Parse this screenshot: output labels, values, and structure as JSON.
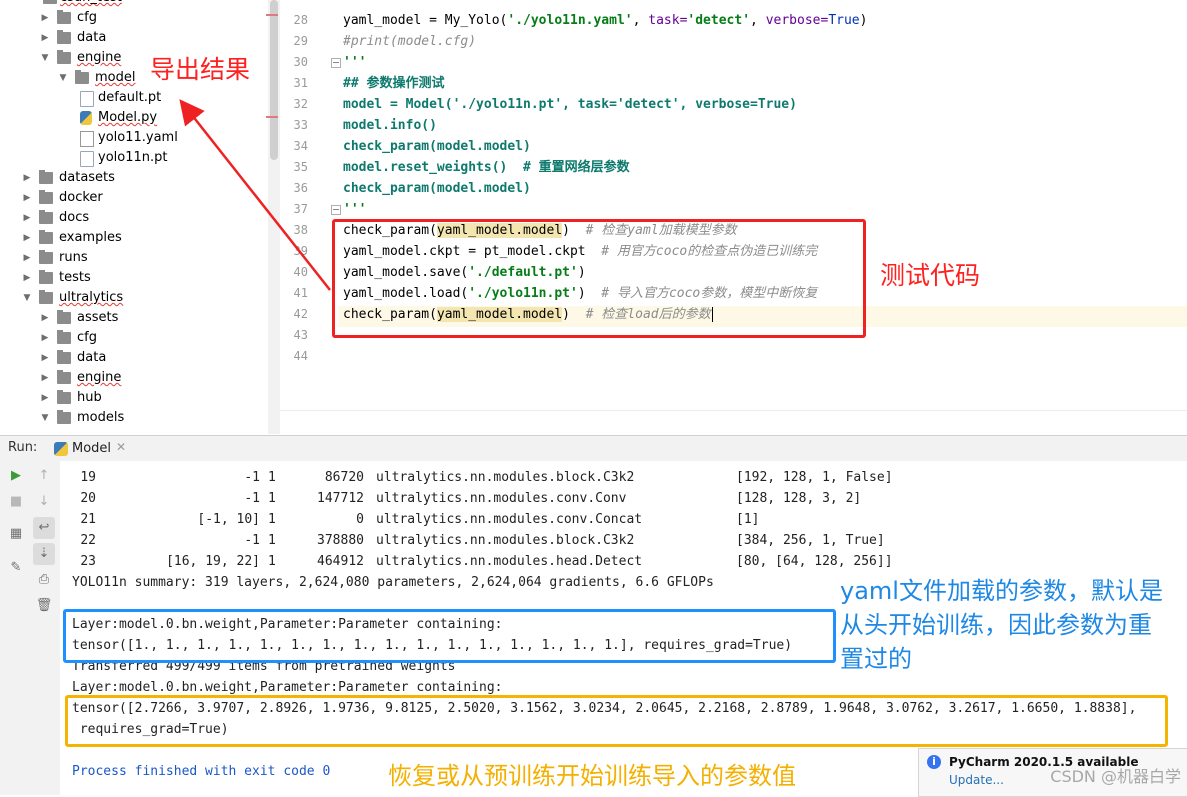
{
  "project_tree": {
    "cut_label": "csdn_test",
    "items": [
      {
        "label": "cfg",
        "type": "folder",
        "expanded": false
      },
      {
        "label": "data",
        "type": "folder",
        "expanded": false
      },
      {
        "label": "engine",
        "type": "folder",
        "expanded": true
      },
      {
        "label": "model",
        "type": "folder",
        "expanded": true
      },
      {
        "label": "default.pt",
        "type": "file"
      },
      {
        "label": "Model.py",
        "type": "python-file"
      },
      {
        "label": "yolo11.yaml",
        "type": "yaml-file"
      },
      {
        "label": "yolo11n.pt",
        "type": "file"
      },
      {
        "label": "datasets",
        "type": "folder",
        "expanded": false
      },
      {
        "label": "docker",
        "type": "folder",
        "expanded": false
      },
      {
        "label": "docs",
        "type": "folder",
        "expanded": false
      },
      {
        "label": "examples",
        "type": "folder",
        "expanded": false
      },
      {
        "label": "runs",
        "type": "folder",
        "expanded": false
      },
      {
        "label": "tests",
        "type": "folder",
        "expanded": false
      },
      {
        "label": "ultralytics",
        "type": "folder",
        "expanded": true
      },
      {
        "label": "assets",
        "type": "folder",
        "expanded": false
      },
      {
        "label": "cfg",
        "type": "folder",
        "expanded": false
      },
      {
        "label": "data",
        "type": "folder",
        "expanded": false
      },
      {
        "label": "engine",
        "type": "folder",
        "expanded": false
      },
      {
        "label": "hub",
        "type": "folder",
        "expanded": false
      },
      {
        "label": "models",
        "type": "folder",
        "expanded": true
      }
    ]
  },
  "editor": {
    "line_numbers": [
      "28",
      "29",
      "30",
      "31",
      "32",
      "33",
      "34",
      "35",
      "36",
      "37",
      "38",
      "39",
      "40",
      "41",
      "42",
      "43",
      "44"
    ],
    "lines": {
      "l28_a": "yaml_model = My_Yolo(",
      "l28_b": "'./yolo11n.yaml'",
      "l28_c": ", ",
      "l28_d": "task=",
      "l28_e": "'detect'",
      "l28_f": ", ",
      "l28_g": "verbose=",
      "l28_h": "True",
      "l28_i": ")",
      "l29": "#print(model.cfg)",
      "l30": "'''",
      "l31": "## 参数操作测试",
      "l32": "model = Model('./yolo11n.pt', task='detect', verbose=True)",
      "l33": "model.info()",
      "l34": "check_param(model.model)",
      "l35_a": "model.reset_weights()  ",
      "l35_b": "# 重置网络层参数",
      "l36": "check_param(model.model)",
      "l37": "'''",
      "l38_a": "check_param(",
      "l38_b": "yaml_model.model",
      "l38_c": ")  ",
      "l38_d": "# 检查yaml加载模型参数",
      "l39_a": "yaml_model.ckpt = pt_model.ckpt  ",
      "l39_b": "# 用官方coco的检查点伪造已训练完",
      "l40_a": "yaml_model.save(",
      "l40_b": "'./default.pt'",
      "l40_c": ")",
      "l41_a": "yaml_model.load(",
      "l41_b": "'./yolo11n.pt'",
      "l41_c": ")  ",
      "l41_d": "# 导入官方coco参数，模型中断恢复",
      "l42_a": "check_param(",
      "l42_b": "yaml_model.model",
      "l42_c": ")  ",
      "l42_d": "# 检查load后的参数"
    }
  },
  "run_window": {
    "label": "Run:",
    "tab_label": "Model",
    "table_rows": [
      {
        "idx": "19",
        "from": "-1",
        "n": "1",
        "params": "86720",
        "module": "ultralytics.nn.modules.block.C3k2",
        "args": "[192, 128, 1, False]"
      },
      {
        "idx": "20",
        "from": "-1",
        "n": "1",
        "params": "147712",
        "module": "ultralytics.nn.modules.conv.Conv",
        "args": "[128, 128, 3, 2]"
      },
      {
        "idx": "21",
        "from": "[-1, 10]",
        "n": "1",
        "params": "0",
        "module": "ultralytics.nn.modules.conv.Concat",
        "args": "[1]"
      },
      {
        "idx": "22",
        "from": "-1",
        "n": "1",
        "params": "378880",
        "module": "ultralytics.nn.modules.block.C3k2",
        "args": "[384, 256, 1, True]"
      },
      {
        "idx": "23",
        "from": "[16, 19, 22]",
        "n": "1",
        "params": "464912",
        "module": "ultralytics.nn.modules.head.Detect",
        "args": "[80, [64, 128, 256]]"
      }
    ],
    "summary": "YOLO11n summary: 319 layers, 2,624,080 parameters, 2,624,064 gradients, 6.6 GFLOPs",
    "param_header_1": "Layer:model.0.bn.weight,Parameter:Parameter containing:",
    "tensor_ones": "tensor([1., 1., 1., 1., 1., 1., 1., 1., 1., 1., 1., 1., 1., 1., 1., 1.], requires_grad=True)",
    "transferred": "Transferred 499/499 items from pretrained weights",
    "param_header_2": "Layer:model.0.bn.weight,Parameter:Parameter containing:",
    "tensor_loaded": "tensor([2.7266, 3.9707, 2.8926, 1.9736, 9.8125, 2.5020, 3.1562, 3.0234, 2.0645, 2.2168, 2.8789, 1.9648, 3.0762, 3.2617, 1.6650, 1.8838],",
    "tensor_loaded_2": " requires_grad=True)",
    "exit": "Process finished with exit code 0"
  },
  "annotations": {
    "export_result": "导出结果",
    "test_code": "测试代码",
    "yaml_note_1": "yaml文件加载的参数，默认是",
    "yaml_note_2": "从头开始训练，因此参数为重",
    "yaml_note_3": "置过的",
    "restore_note": "恢复或从预训练开始训练导入的参数值"
  },
  "notification": {
    "title": "PyCharm 2020.1.5 available",
    "link": "Update..."
  },
  "watermark": "CSDN @机器白学",
  "colors": {
    "annotation_red": "#ff2020",
    "annotation_blue": "#1e88e5",
    "annotation_yellow": "#f4b000",
    "string_green": "#067d17",
    "comment_gray": "#8c8c8c"
  }
}
